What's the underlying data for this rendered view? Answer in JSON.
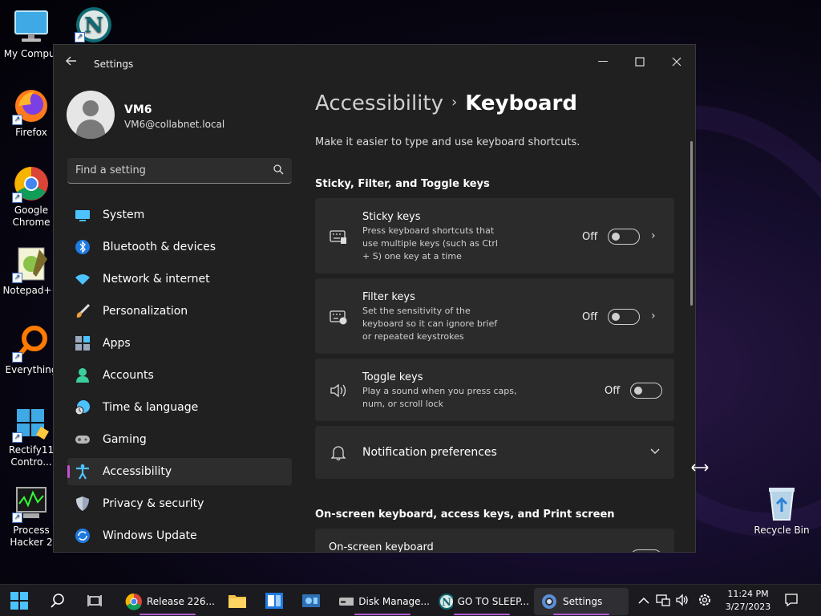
{
  "desktop": {
    "icons": [
      {
        "label": "My Comput",
        "icon": "monitor-icon"
      },
      {
        "label": "Firefox",
        "icon": "firefox-icon"
      },
      {
        "label": "Google Chrome",
        "icon": "chrome-icon"
      },
      {
        "label": "Notepad++",
        "icon": "notepad-plus-plus-icon"
      },
      {
        "label": "Everything",
        "icon": "everything-search-icon"
      },
      {
        "label": "Rectify11 Contro...",
        "icon": "rectify11-icon"
      },
      {
        "label": "Process Hacker 2",
        "icon": "process-hacker-icon"
      },
      {
        "label": "Recycle Bin",
        "icon": "recycle-bin-icon"
      }
    ]
  },
  "window": {
    "title": "Settings",
    "accent_color": "#c64fd6"
  },
  "profile": {
    "name": "VM6",
    "email": "VM6@collabnet.local"
  },
  "search": {
    "placeholder": "Find a setting"
  },
  "nav": {
    "items": [
      {
        "label": "System",
        "icon": "system-icon"
      },
      {
        "label": "Bluetooth & devices",
        "icon": "bluetooth-icon"
      },
      {
        "label": "Network & internet",
        "icon": "wifi-icon"
      },
      {
        "label": "Personalization",
        "icon": "brush-icon"
      },
      {
        "label": "Apps",
        "icon": "apps-icon"
      },
      {
        "label": "Accounts",
        "icon": "person-icon"
      },
      {
        "label": "Time & language",
        "icon": "clock-globe-icon"
      },
      {
        "label": "Gaming",
        "icon": "gamepad-icon"
      },
      {
        "label": "Accessibility",
        "icon": "accessibility-icon",
        "active": true
      },
      {
        "label": "Privacy & security",
        "icon": "shield-icon"
      },
      {
        "label": "Windows Update",
        "icon": "update-icon"
      }
    ]
  },
  "page": {
    "breadcrumb_parent": "Accessibility",
    "breadcrumb_current": "Keyboard",
    "subtitle": "Make it easier to type and use keyboard shortcuts.",
    "section1": "Sticky, Filter, and Toggle keys",
    "section2": "On-screen keyboard, access keys, and Print screen",
    "sticky": {
      "title": "Sticky keys",
      "desc": "Press keyboard shortcuts that use multiple keys (such as Ctrl + S) one key at a time",
      "state": "Off"
    },
    "filter": {
      "title": "Filter keys",
      "desc": "Set the sensitivity of the keyboard so it can ignore brief or repeated keystrokes",
      "state": "Off"
    },
    "toggle": {
      "title": "Toggle keys",
      "desc": "Play a sound when you press caps, num, or scroll lock",
      "state": "Off"
    },
    "notification": {
      "title": "Notification preferences"
    },
    "onscreen": {
      "title": "On-screen keyboard"
    }
  },
  "taskbar": {
    "apps": [
      {
        "label": "Release 226...",
        "icon": "chrome-icon"
      },
      {
        "label": "Disk Manage...",
        "icon": "disk-management-icon"
      },
      {
        "label": "GO TO SLEEP...",
        "icon": "netscape-icon"
      },
      {
        "label": "Settings",
        "icon": "settings-gear-icon"
      }
    ],
    "time": "11:24 PM",
    "date": "3/27/2023"
  }
}
